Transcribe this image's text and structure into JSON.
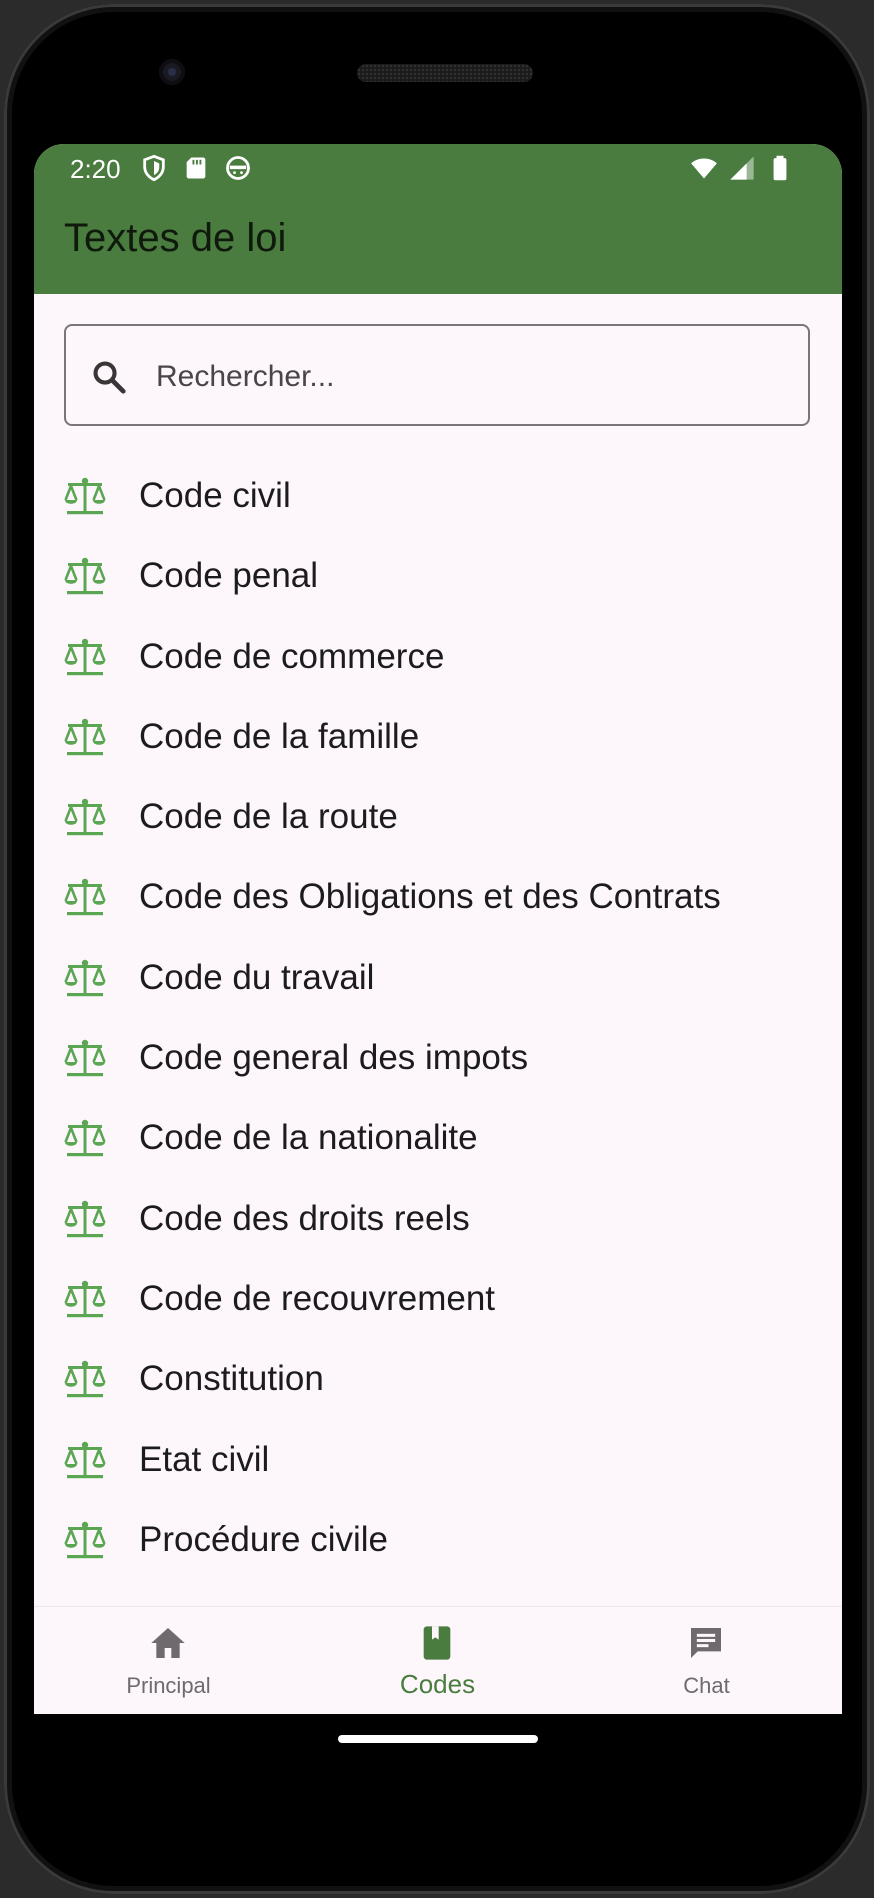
{
  "status_bar": {
    "time": "2:20",
    "left_icons": [
      "shield-icon",
      "sd-card-icon",
      "face-icon"
    ],
    "right_icons": [
      "wifi-icon",
      "signal-icon",
      "battery-icon"
    ]
  },
  "app_bar": {
    "title": "Textes de loi",
    "background_color": "#497c3e"
  },
  "search": {
    "placeholder": "Rechercher...",
    "value": "",
    "icon": "search-icon"
  },
  "list": {
    "icon": "balance-scale-icon",
    "icon_color": "#5aa653",
    "items": [
      {
        "label": "Code civil"
      },
      {
        "label": "Code penal"
      },
      {
        "label": "Code de commerce"
      },
      {
        "label": "Code de la famille"
      },
      {
        "label": "Code de la route"
      },
      {
        "label": "Code des Obligations et des Contrats"
      },
      {
        "label": "Code du travail"
      },
      {
        "label": "Code general des impots"
      },
      {
        "label": "Code de la nationalite"
      },
      {
        "label": "Code des droits reels"
      },
      {
        "label": "Code de recouvrement"
      },
      {
        "label": "Constitution"
      },
      {
        "label": "Etat civil"
      },
      {
        "label": "Procédure civile"
      }
    ]
  },
  "bottom_nav": {
    "items": [
      {
        "label": "Principal",
        "icon": "home-icon",
        "active": false
      },
      {
        "label": "Codes",
        "icon": "book-icon",
        "active": true
      },
      {
        "label": "Chat",
        "icon": "chat-icon",
        "active": false
      }
    ],
    "active_color": "#497c3e",
    "inactive_color": "#6e6a6d"
  }
}
